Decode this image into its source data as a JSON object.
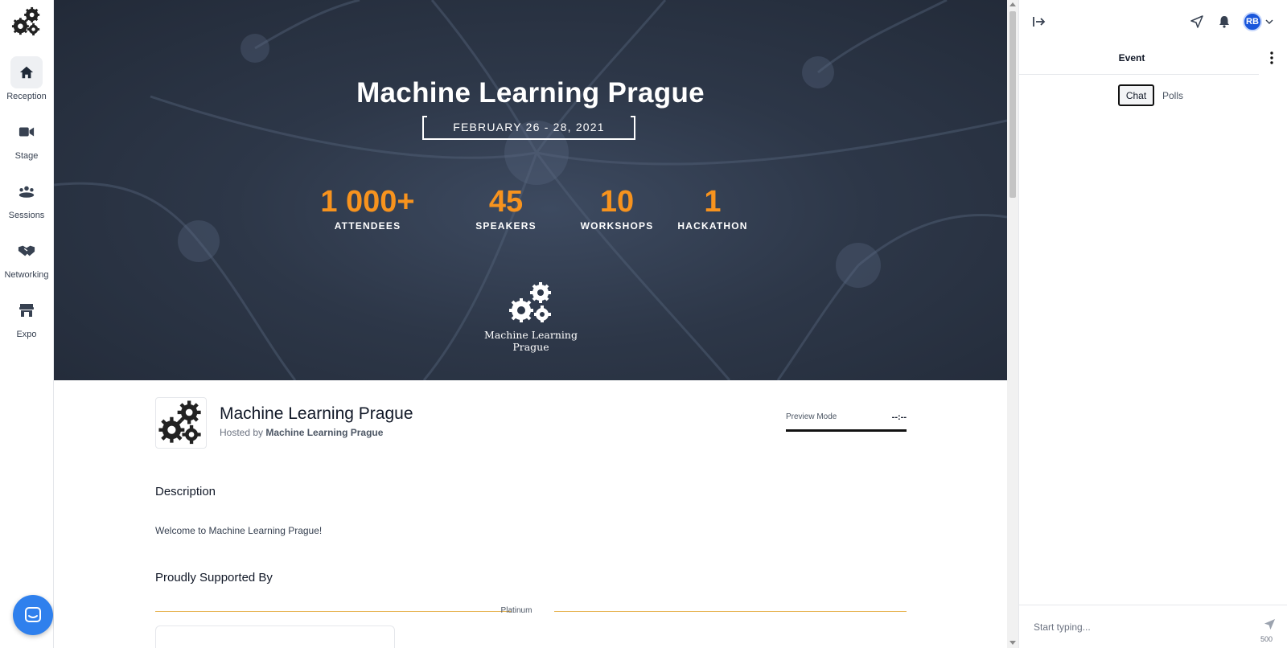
{
  "nav": {
    "items": [
      {
        "label": "Reception",
        "icon": "home-icon"
      },
      {
        "label": "Stage",
        "icon": "video-camera-icon"
      },
      {
        "label": "Sessions",
        "icon": "group-icon"
      },
      {
        "label": "Networking",
        "icon": "handshake-icon"
      },
      {
        "label": "Expo",
        "icon": "store-icon"
      }
    ]
  },
  "hero": {
    "title": "Machine Learning Prague",
    "date": "FEBRUARY 26 - 28, 2021",
    "stats": [
      {
        "value": "1 000+",
        "label": "ATTENDEES"
      },
      {
        "value": "45",
        "label": "SPEAKERS"
      },
      {
        "value": "10",
        "label": "WORKSHOPS"
      },
      {
        "value": "1",
        "label": "HACKATHON"
      }
    ],
    "logo_text": "Machine Learning Prague"
  },
  "event": {
    "name": "Machine Learning Prague",
    "hosted_prefix": "Hosted by",
    "host": "Machine Learning Prague",
    "preview_label": "Preview Mode",
    "timer": "--:--"
  },
  "description": {
    "title": "Description",
    "text": "Welcome to Machine Learning Prague!"
  },
  "sponsors": {
    "title": "Proudly Supported By",
    "tier": "Platinum"
  },
  "panel": {
    "title": "Event",
    "tabs": [
      "Chat",
      "Polls"
    ],
    "avatar_initials": "RB",
    "input_placeholder": "Start typing...",
    "char_limit": "500"
  },
  "colors": {
    "accent_orange": "#f7931e",
    "avatar_blue": "#1a56db",
    "intercom_blue": "#2f80ed",
    "tier_gold": "#e5b04a"
  }
}
